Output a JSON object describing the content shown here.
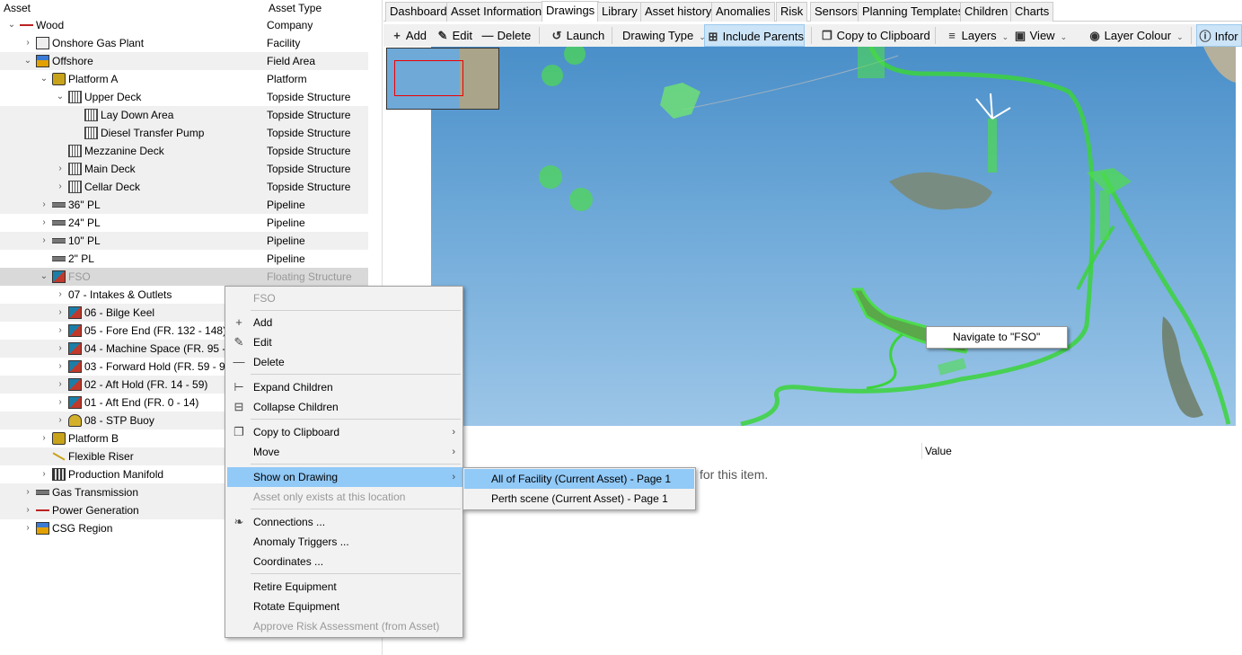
{
  "tree": {
    "headers": {
      "asset": "Asset",
      "type": "Asset Type"
    },
    "rows": [
      {
        "label": "Wood",
        "type": "Company",
        "icon": "arrow-icon"
      },
      {
        "label": "Onshore Gas Plant",
        "type": "Facility",
        "icon": "plant-icon"
      },
      {
        "label": "Offshore",
        "type": "Field Area",
        "icon": "region-icon"
      },
      {
        "label": "Platform A",
        "type": "Platform",
        "icon": "platform-icon"
      },
      {
        "label": "Upper Deck",
        "type": "Topside Structure",
        "icon": "deck-icon"
      },
      {
        "label": "Lay Down Area",
        "type": "Topside Structure",
        "icon": "deck-icon"
      },
      {
        "label": "Diesel Transfer Pump",
        "type": "Topside Structure",
        "icon": "deck-icon"
      },
      {
        "label": "Mezzanine Deck",
        "type": "Topside Structure",
        "icon": "deck-icon"
      },
      {
        "label": "Main Deck",
        "type": "Topside Structure",
        "icon": "deck-icon"
      },
      {
        "label": "Cellar Deck",
        "type": "Topside Structure",
        "icon": "deck-icon"
      },
      {
        "label": "36\" PL",
        "type": "Pipeline",
        "icon": "pipe-icon"
      },
      {
        "label": "24\" PL",
        "type": "Pipeline",
        "icon": "pipe-icon"
      },
      {
        "label": "10\" PL",
        "type": "Pipeline",
        "icon": "pipe-icon"
      },
      {
        "label": "2\" PL",
        "type": "Pipeline",
        "icon": "pipe-icon"
      },
      {
        "label": "FSO",
        "type": "Floating Structure",
        "icon": "fso-icon"
      },
      {
        "label": "07 - Intakes & Outlets",
        "type": "",
        "icon": ""
      },
      {
        "label": "06 - Bilge Keel",
        "type": "",
        "icon": "fso-icon"
      },
      {
        "label": "05 - Fore End (FR. 132 - 148)",
        "type": "",
        "icon": "fso-icon"
      },
      {
        "label": "04 - Machine Space (FR. 95 - 1",
        "type": "",
        "icon": "fso-icon"
      },
      {
        "label": "03 - Forward Hold (FR. 59 - 95",
        "type": "",
        "icon": "fso-icon"
      },
      {
        "label": "02 - Aft Hold (FR. 14 - 59)",
        "type": "",
        "icon": "fso-icon"
      },
      {
        "label": "01 - Aft End (FR. 0 - 14)",
        "type": "",
        "icon": "fso-icon"
      },
      {
        "label": "08 - STP Buoy",
        "type": "",
        "icon": "buoy-icon"
      },
      {
        "label": "Platform B",
        "type": "",
        "icon": "platform-icon"
      },
      {
        "label": "Flexible Riser",
        "type": "",
        "icon": "riser-icon"
      },
      {
        "label": "Production Manifold",
        "type": "",
        "icon": "manifold-icon"
      },
      {
        "label": "Gas Transmission",
        "type": "",
        "icon": "pipe-icon"
      },
      {
        "label": "Power Generation",
        "type": "",
        "icon": "arrow-icon"
      },
      {
        "label": "CSG Region",
        "type": "",
        "icon": "region-icon"
      }
    ]
  },
  "tabs": [
    "Dashboard",
    "Asset Information",
    "Drawings",
    "Library",
    "Asset history",
    "Anomalies",
    "Risk",
    "Sensors",
    "Planning Templates",
    "Children",
    "Charts"
  ],
  "active_tab": "Drawings",
  "toolbar": {
    "add": "Add",
    "edit": "Edit",
    "delete": "Delete",
    "launch": "Launch",
    "drawing_type": "Drawing Type",
    "include_parents": "Include Parents",
    "copy_clipboard": "Copy to Clipboard",
    "layers": "Layers",
    "view": "View",
    "layer_colour": "Layer Colour",
    "info": "Infor"
  },
  "map": {
    "navigate_tooltip": "Navigate to \"FSO\"",
    "highlight_color": "#4ddc4d",
    "pipeline_color": "#3bd43b",
    "minimap_frame_color": "#e00000"
  },
  "properties": {
    "value_header": "Value",
    "empty_message": "for this item."
  },
  "context_menu": {
    "title": "FSO",
    "items": {
      "add": "Add",
      "edit": "Edit",
      "delete": "Delete",
      "expand": "Expand Children",
      "collapse": "Collapse Children",
      "copy": "Copy to Clipboard",
      "move": "Move",
      "show_on_drawing": "Show on Drawing",
      "only_exists": "Asset only exists at this location",
      "connections": "Connections ...",
      "anomaly_triggers": "Anomaly Triggers ...",
      "coordinates": "Coordinates ...",
      "retire": "Retire Equipment",
      "rotate": "Rotate Equipment",
      "approve_risk": "Approve Risk Assessment (from Asset)"
    }
  },
  "submenu": {
    "items": [
      "All of Facility (Current Asset) - Page 1",
      "Perth scene (Current Asset) - Page 1"
    ]
  }
}
